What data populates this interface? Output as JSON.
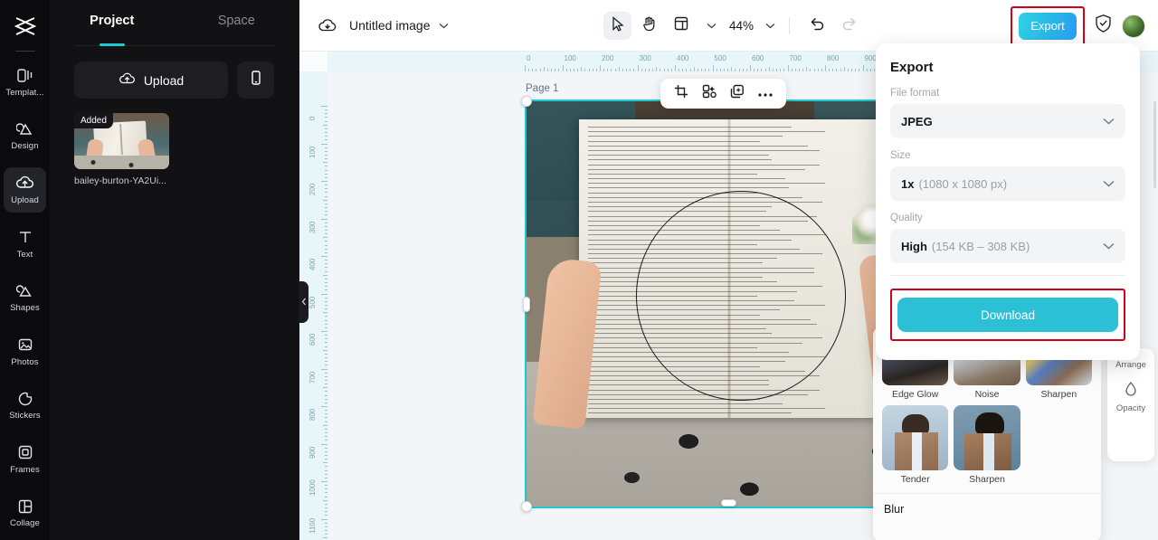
{
  "app": {
    "logo_icon": "capcut-logo-icon"
  },
  "rail": {
    "items": [
      {
        "label": "Templat...",
        "icon": "templates-icon",
        "active": false
      },
      {
        "label": "Design",
        "icon": "design-icon",
        "active": false
      },
      {
        "label": "Upload",
        "icon": "upload-cloud-icon",
        "active": true
      },
      {
        "label": "Text",
        "icon": "text-icon",
        "active": false
      },
      {
        "label": "Shapes",
        "icon": "shapes-icon",
        "active": false
      },
      {
        "label": "Photos",
        "icon": "photos-icon",
        "active": false
      },
      {
        "label": "Stickers",
        "icon": "stickers-icon",
        "active": false
      },
      {
        "label": "Frames",
        "icon": "frames-icon",
        "active": false
      },
      {
        "label": "Collage",
        "icon": "collage-icon",
        "active": false
      }
    ]
  },
  "panel": {
    "tabs": [
      {
        "label": "Project",
        "active": true
      },
      {
        "label": "Space",
        "active": false
      }
    ],
    "accent": "#1ec8d0",
    "upload_label": "Upload",
    "phone_button_icon": "mobile-icon",
    "asset": {
      "badge": "Added",
      "name": "bailey-burton-YA2Ui..."
    }
  },
  "topbar": {
    "cloud_icon": "cloud-save-icon",
    "doc_title": "Untitled image",
    "title_caret_icon": "chevron-down-icon",
    "tools": [
      {
        "name": "select-tool",
        "icon": "cursor-icon",
        "active": true
      },
      {
        "name": "hand-tool",
        "icon": "hand-icon",
        "active": false
      },
      {
        "name": "layout-tool",
        "icon": "layout-icon",
        "active": false
      }
    ],
    "layout_caret_icon": "chevron-down-icon",
    "zoom": "44%",
    "zoom_caret_icon": "chevron-down-icon",
    "undo_icon": "undo-icon",
    "redo_icon": "redo-icon",
    "export_label": "Export",
    "shield_icon": "shield-check-icon",
    "avatar_name": "user-avatar"
  },
  "canvas": {
    "page_label": "Page 1",
    "ruler_h_labels": [
      "0",
      "100",
      "200",
      "300",
      "400",
      "500",
      "600",
      "700",
      "800",
      "900"
    ],
    "ruler_v_labels": [
      "0",
      "100",
      "200",
      "300",
      "400",
      "500",
      "600",
      "700",
      "800",
      "900",
      "1000",
      "1100"
    ],
    "float_toolbar": [
      {
        "name": "crop-button",
        "icon": "crop-icon"
      },
      {
        "name": "remove-bg-button",
        "icon": "magic-cutout-icon"
      },
      {
        "name": "duplicate-button",
        "icon": "duplicate-icon"
      },
      {
        "name": "more-button",
        "icon": "ellipsis-icon"
      }
    ],
    "collapse_icon": "chevron-left-icon"
  },
  "effects_panel": {
    "items": [
      {
        "label": "Edge Glow"
      },
      {
        "label": "Noise"
      },
      {
        "label": "Sharpen"
      },
      {
        "label": "Tender"
      },
      {
        "label": "Sharpen"
      }
    ],
    "section_title": "Blur"
  },
  "right_tools": {
    "arrange_label": "Arrange",
    "opacity_label": "Opacity",
    "opacity_icon": "droplet-icon"
  },
  "export_panel": {
    "title": "Export",
    "file_format": {
      "label": "File format",
      "value": "JPEG",
      "caret_icon": "chevron-down-icon"
    },
    "size": {
      "label": "Size",
      "value": "1x",
      "detail": "(1080 x 1080 px)",
      "caret_icon": "chevron-down-icon"
    },
    "quality": {
      "label": "Quality",
      "value": "High",
      "detail": "(154 KB – 308 KB)",
      "caret_icon": "chevron-down-icon"
    },
    "download_label": "Download",
    "accent": "#2cc0d6",
    "highlight_color": "#d0021b"
  }
}
